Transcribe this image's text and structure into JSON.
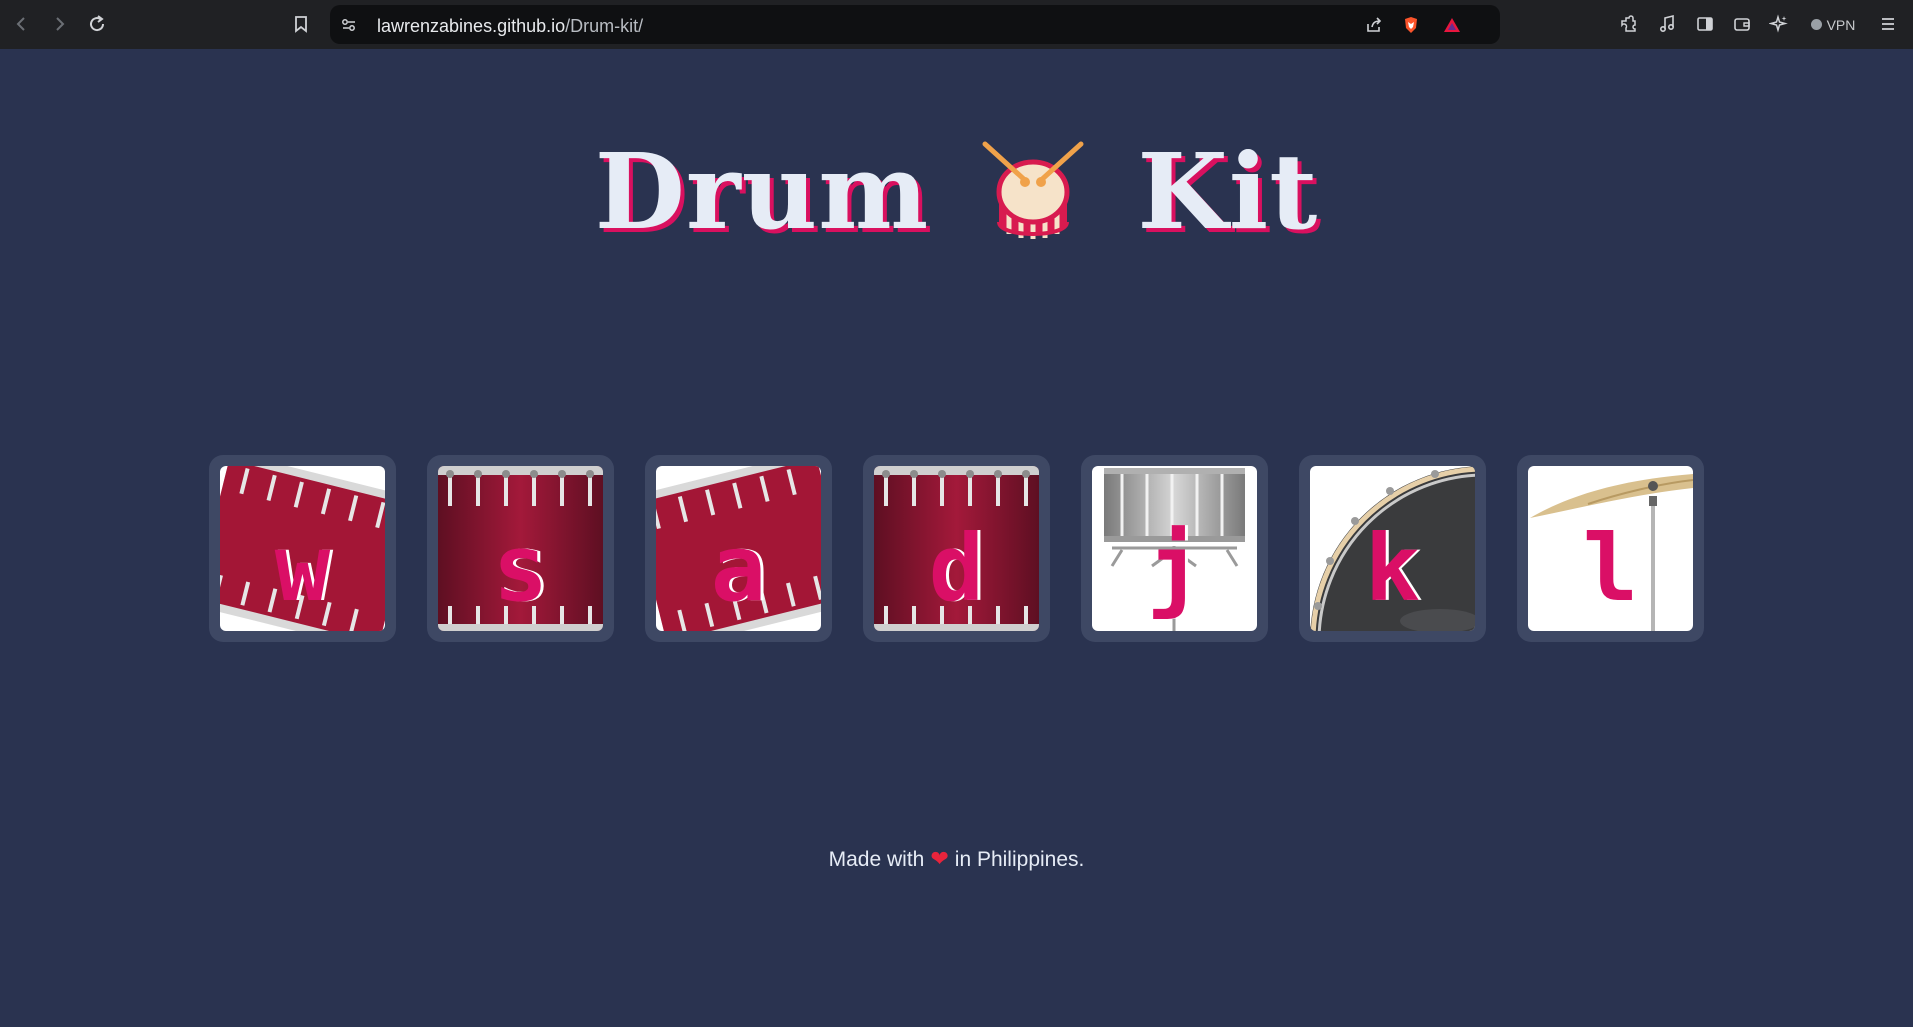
{
  "browser": {
    "url_host": "lawrenzabines.github.io",
    "url_path": "/Drum-kit/",
    "vpn_label": "VPN",
    "icons": [
      "back-icon",
      "forward-icon",
      "reload-icon",
      "bookmark-icon",
      "site-settings-icon",
      "share-icon",
      "brave-shield-icon",
      "brave-rewards-icon",
      "extensions-icon",
      "media-icon",
      "sidebar-icon",
      "wallet-icon",
      "leo-ai-icon",
      "menu-icon"
    ]
  },
  "page": {
    "title_left": "Drum",
    "title_right": "Kit",
    "title_icon": "drum-icon",
    "footer_before": "Made with",
    "footer_heart": "❤",
    "footer_after": "in Philippines.",
    "colors": {
      "background": "#2a3350",
      "pad_border": "#3e4864",
      "key_letter": "#da0f66",
      "title_text": "#e6ecf6",
      "title_shadow": "#d9105f"
    }
  },
  "pads": [
    {
      "key": "w",
      "image": "tom-drum-tilted"
    },
    {
      "key": "s",
      "image": "tom-drum"
    },
    {
      "key": "a",
      "image": "tom-drum-tilted"
    },
    {
      "key": "d",
      "image": "tom-drum"
    },
    {
      "key": "j",
      "image": "snare-drum"
    },
    {
      "key": "k",
      "image": "kick-drum"
    },
    {
      "key": "l",
      "image": "crash-cymbal"
    }
  ]
}
